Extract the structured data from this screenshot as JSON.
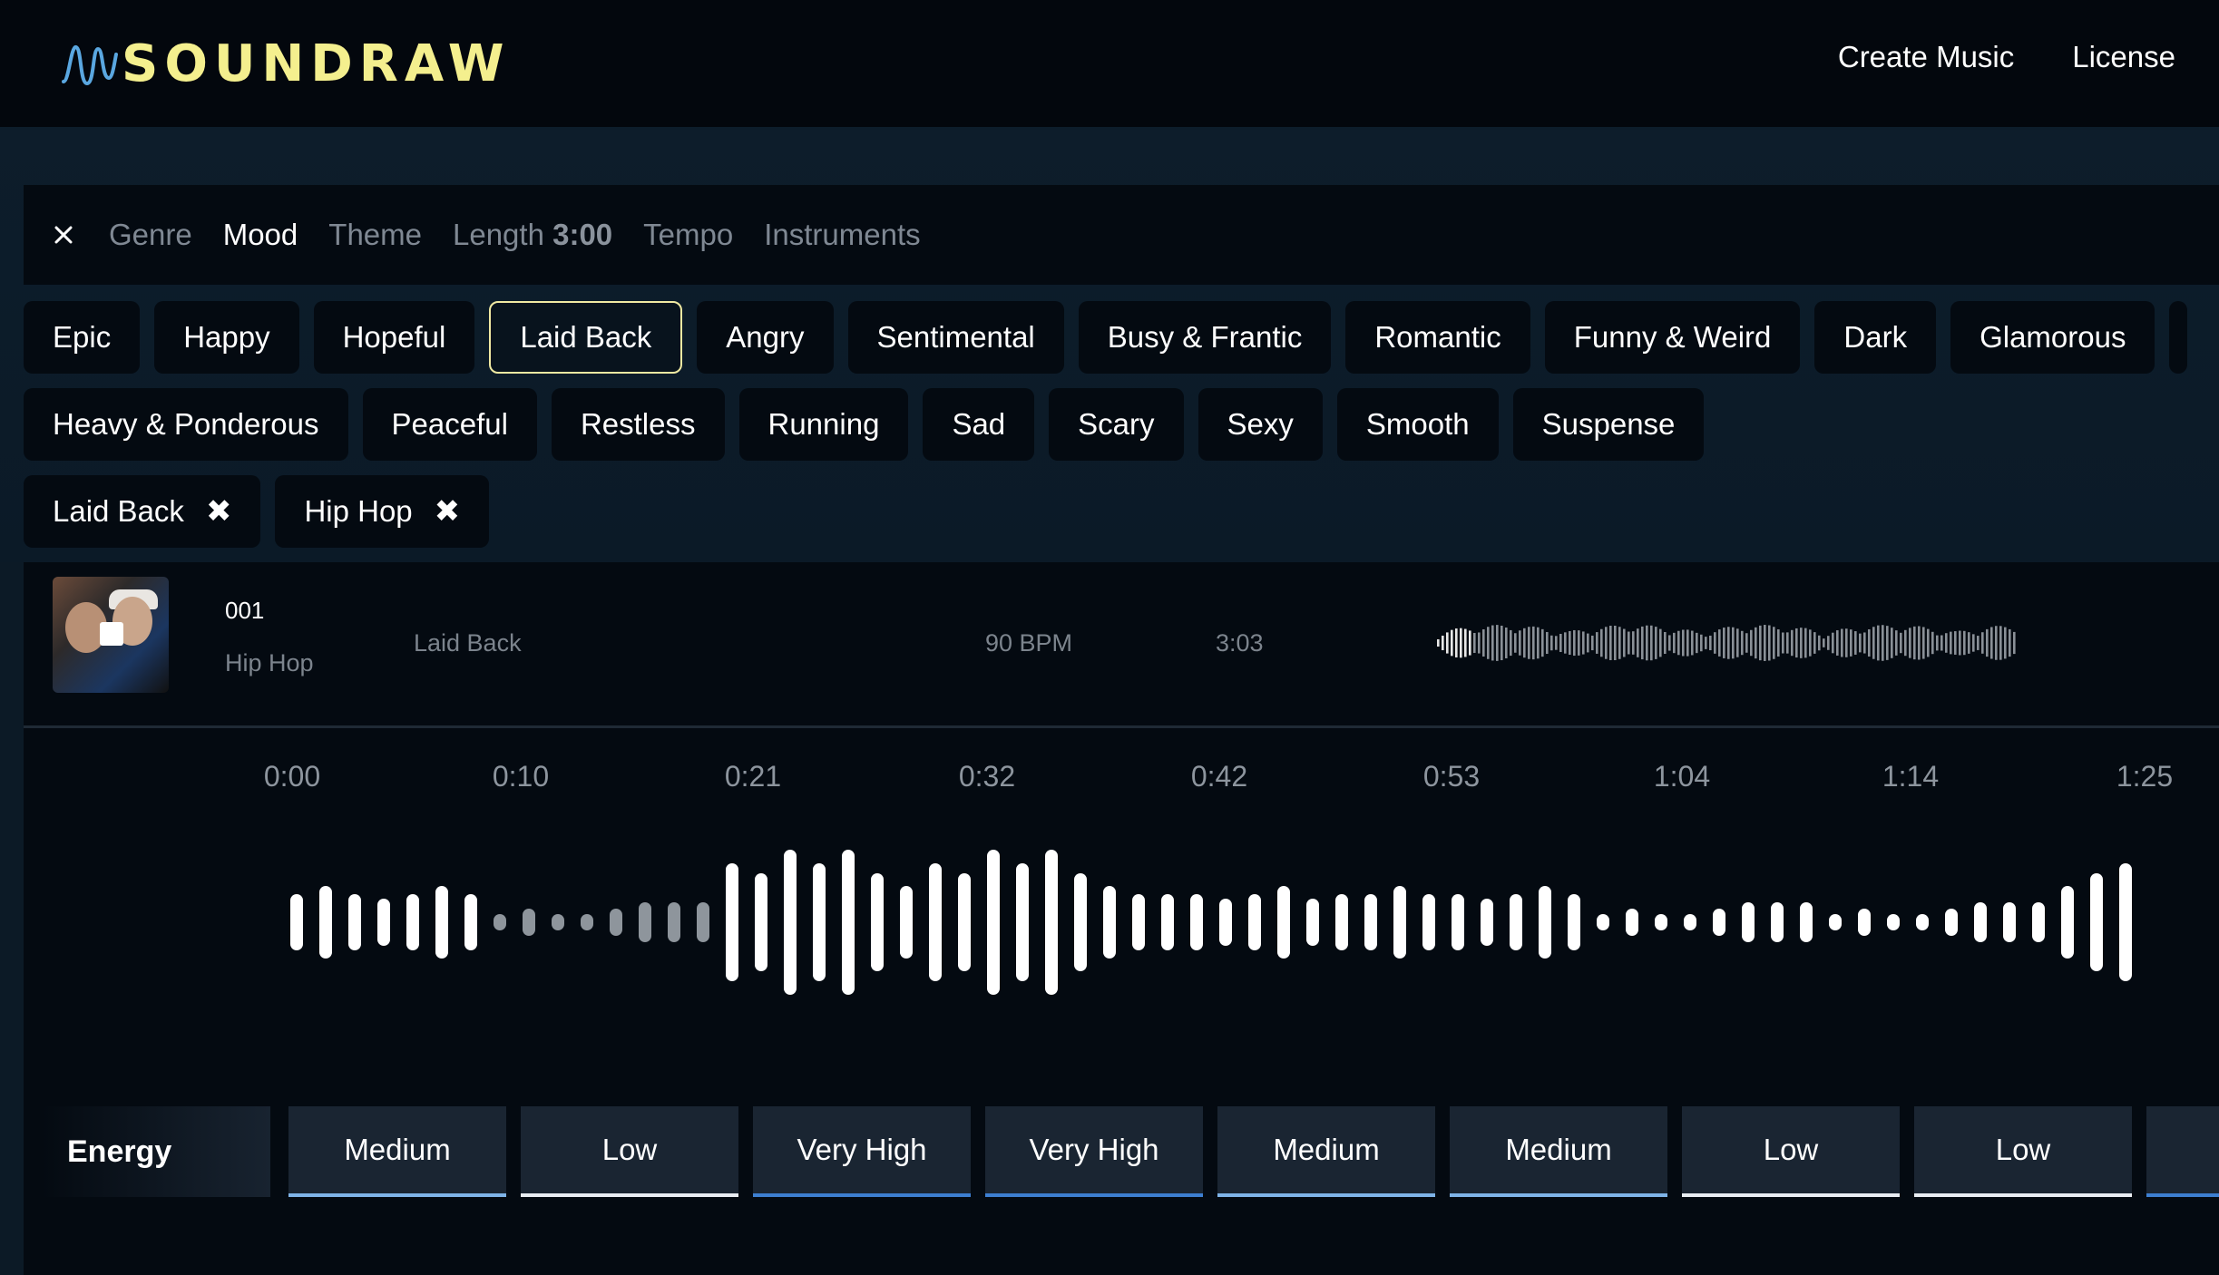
{
  "app": {
    "name": "SOUNDRAW"
  },
  "nav": {
    "items": [
      "Create Music",
      "License"
    ]
  },
  "filter_tabs": {
    "genre": "Genre",
    "mood": "Mood",
    "theme": "Theme",
    "length_label": "Length",
    "length_value": "3:00",
    "tempo": "Tempo",
    "instruments": "Instruments",
    "active": "Mood"
  },
  "moods": {
    "row1": [
      "Epic",
      "Happy",
      "Hopeful",
      "Laid Back",
      "Angry",
      "Sentimental",
      "Busy & Frantic",
      "Romantic",
      "Funny & Weird",
      "Dark",
      "Glamorous"
    ],
    "row2": [
      "Heavy & Ponderous",
      "Peaceful",
      "Restless",
      "Running",
      "Sad",
      "Scary",
      "Sexy",
      "Smooth",
      "Suspense"
    ],
    "selected": "Laid Back"
  },
  "active_filters": [
    {
      "label": "Laid Back",
      "remove": "✖"
    },
    {
      "label": "Hip Hop",
      "remove": "✖"
    }
  ],
  "track": {
    "number": "001",
    "genre": "Hip Hop",
    "mood": "Laid Back",
    "bpm": "90 BPM",
    "duration": "3:03"
  },
  "timeline": {
    "ticks": [
      "0:00",
      "0:10",
      "0:21",
      "0:32",
      "0:42",
      "0:53",
      "1:04",
      "1:14",
      "1:25"
    ]
  },
  "energy": {
    "label": "Energy",
    "segments": [
      "Medium",
      "Low",
      "Very High",
      "Very High",
      "Medium",
      "Medium",
      "Low",
      "Low"
    ]
  },
  "colors": {
    "logo": "#f4ef8e",
    "logo_wave": "#5aa7e0",
    "selected_border": "#f0e9a2",
    "energy_medium": "#7fb4e8",
    "energy_low": "#e8edf2",
    "energy_very_high": "#3d7fd1"
  }
}
